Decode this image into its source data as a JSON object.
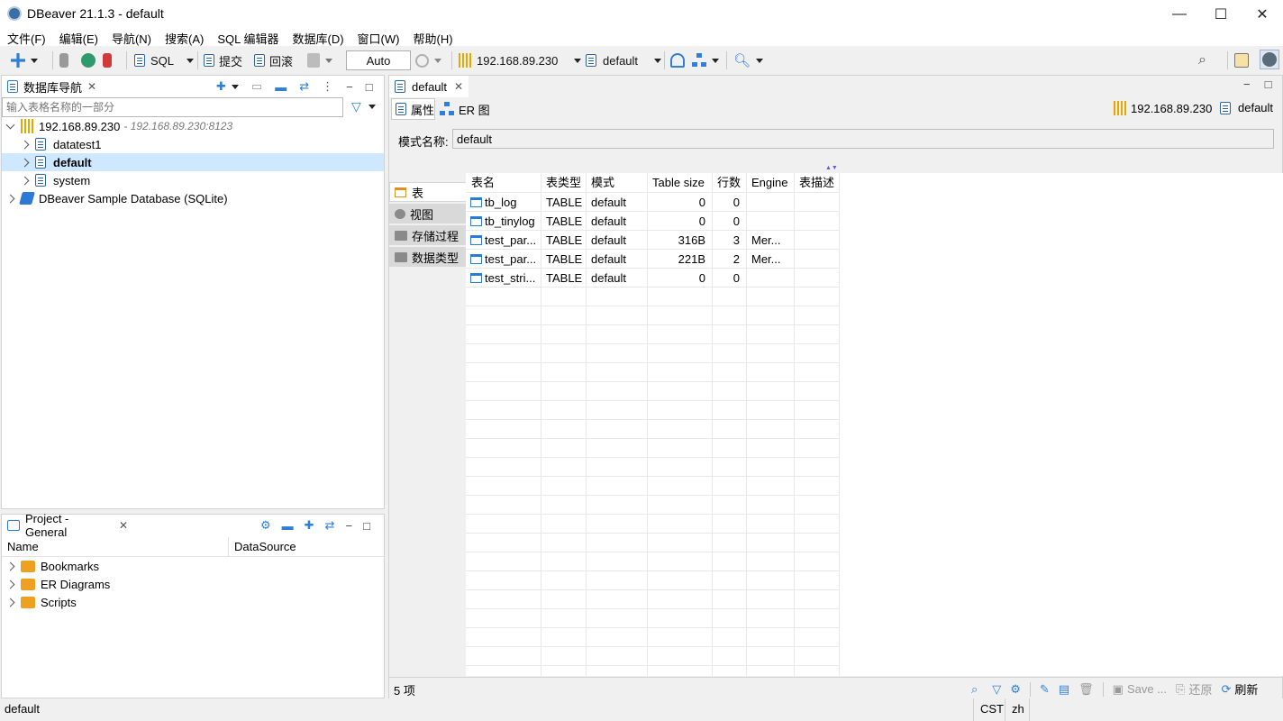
{
  "window": {
    "title": "DBeaver 21.1.3 - default",
    "minimize": "—",
    "maximize": "☐",
    "close": "✕"
  },
  "menu": [
    "文件(F)",
    "编辑(E)",
    "导航(N)",
    "搜索(A)",
    "SQL 编辑器",
    "数据库(D)",
    "窗口(W)",
    "帮助(H)"
  ],
  "toolbar": {
    "sql_label": "SQL",
    "commit_label": "提交",
    "rollback_label": "回滚",
    "tx_mode": "Auto",
    "connection": "192.168.89.230",
    "database": "default"
  },
  "navigator": {
    "tab_label": "数据库导航",
    "filter_placeholder": "输入表格名称的一部分",
    "connection_label": "192.168.89.230",
    "connection_url": " - 192.168.89.230:8123",
    "databases": [
      "datatest1",
      "default",
      "system"
    ],
    "sqlite_label": "DBeaver Sample Database (SQLite)"
  },
  "project": {
    "tab_label": "Project - General",
    "col_name": "Name",
    "col_datasource": "DataSource",
    "items": [
      "Bookmarks",
      "ER Diagrams",
      "Scripts"
    ]
  },
  "editor": {
    "tab_label": "default",
    "subtab_props": "属性",
    "subtab_er": "ER 图",
    "conn_label": "192.168.89.230",
    "db_label": "default",
    "schema_label": "模式名称:",
    "schema_value": "default",
    "side_tabs": [
      "表",
      "视图",
      "存储过程",
      "数据类型"
    ],
    "columns": [
      "表名",
      "表类型",
      "模式",
      "Table size",
      "行数",
      "Engine",
      "表描述"
    ],
    "rows": [
      [
        "tb_log",
        "TABLE",
        "default",
        "0",
        "0",
        "",
        ""
      ],
      [
        "tb_tinylog",
        "TABLE",
        "default",
        "0",
        "0",
        "",
        ""
      ],
      [
        "test_par...",
        "TABLE",
        "default",
        "316B",
        "3",
        "Mer...",
        ""
      ],
      [
        "test_par...",
        "TABLE",
        "default",
        "221B",
        "2",
        "Mer...",
        ""
      ],
      [
        "test_stri...",
        "TABLE",
        "default",
        "0",
        "0",
        "",
        ""
      ]
    ],
    "count_label": "5 项",
    "save_label": "Save ...",
    "revert_label": "还原",
    "refresh_label": "刷新"
  },
  "status": {
    "left": "default",
    "tz": "CST",
    "locale": "zh"
  }
}
